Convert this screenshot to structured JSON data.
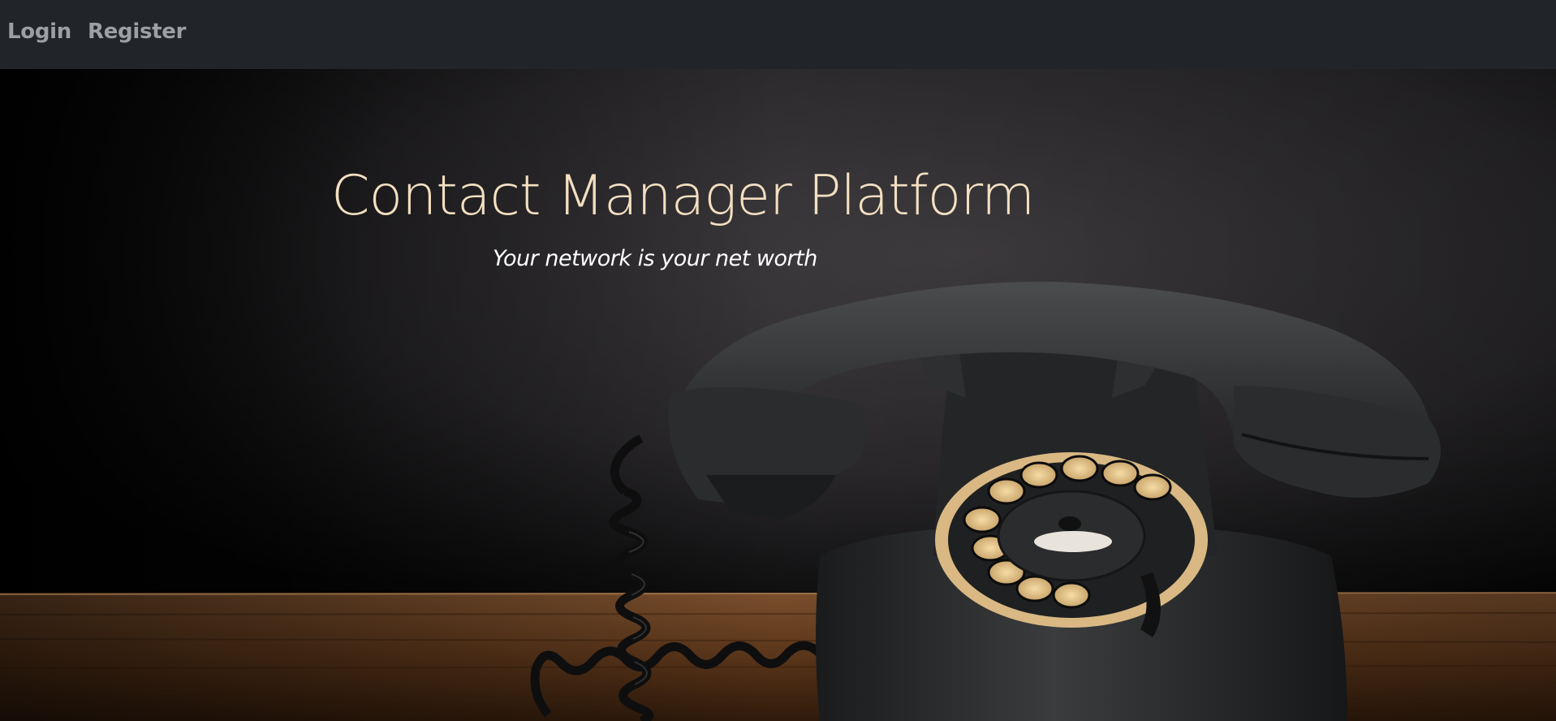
{
  "nav": {
    "login_label": "Login",
    "register_label": "Register"
  },
  "hero": {
    "title": "Contact Manager Platform",
    "subtitle": "Your network is your net worth",
    "background_image": "vintage-rotary-telephone-on-wooden-table",
    "colors": {
      "navbar_bg": "#212529",
      "nav_link": "#9ca0a4",
      "title": "#f3dfc1",
      "subtitle": "#ffffff"
    }
  }
}
